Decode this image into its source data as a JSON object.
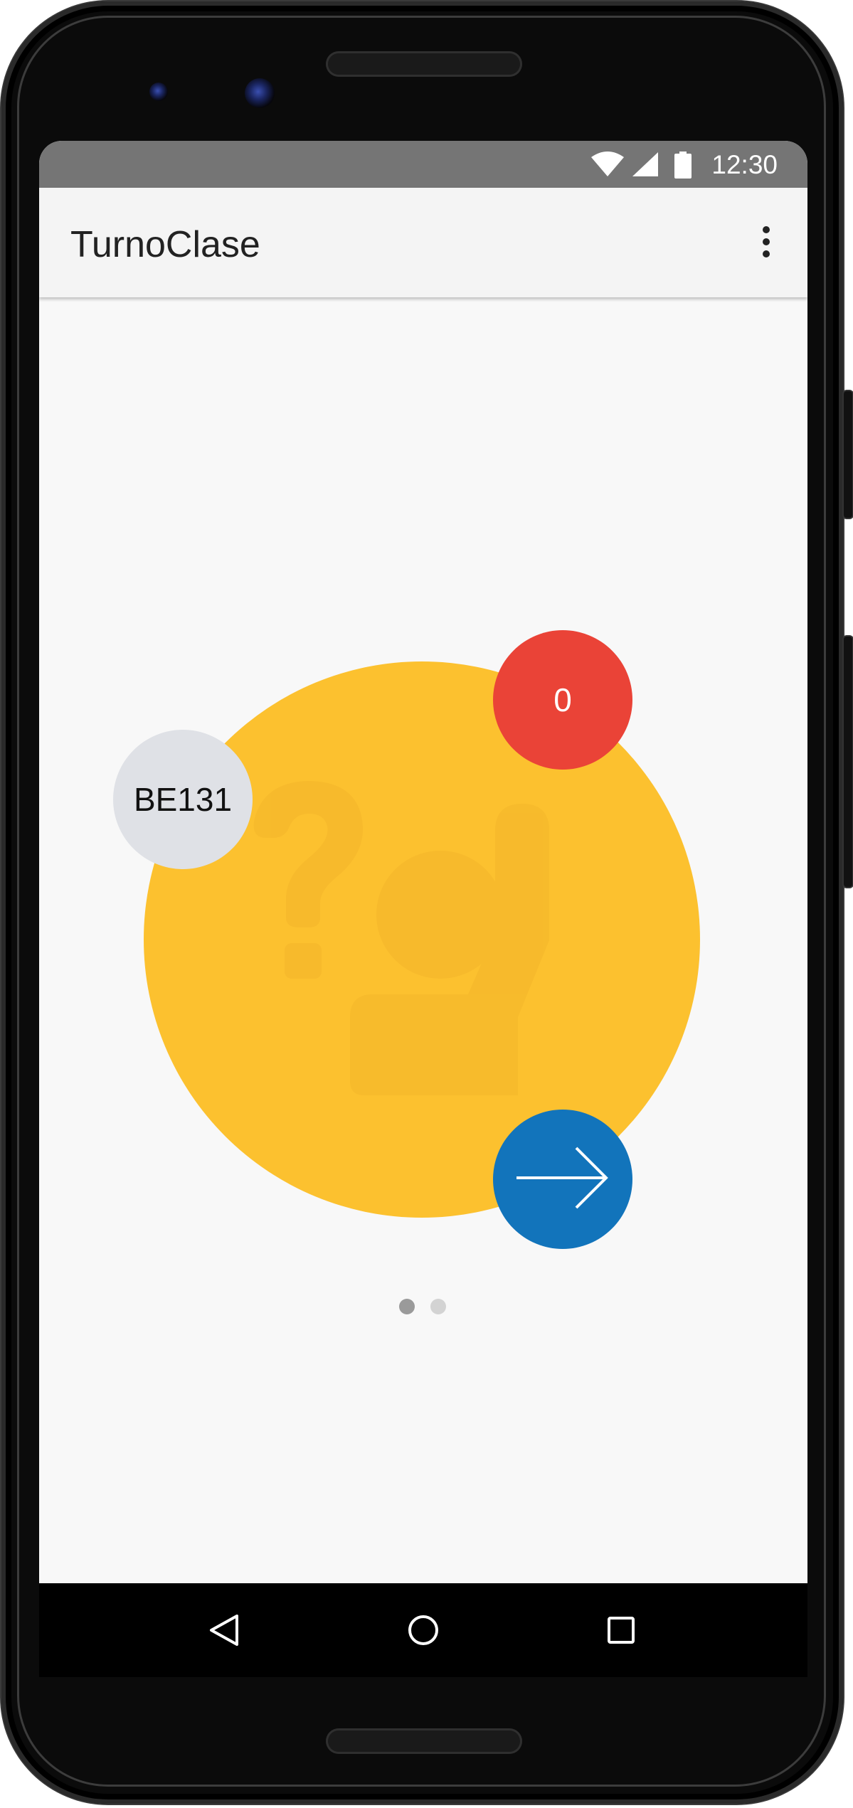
{
  "status_bar": {
    "time": "12:30",
    "icons": [
      "wifi-icon",
      "signal-icon",
      "battery-icon"
    ],
    "color": "#757575"
  },
  "app_bar": {
    "title": "TurnoClase",
    "menu_icon": "overflow-menu-icon"
  },
  "main": {
    "room_code": "BE131",
    "queue_count": "0",
    "center_icon": "student-raise-hand-question-icon",
    "next_icon": "arrow-right-icon",
    "pager": {
      "pages": 2,
      "current": 1
    }
  },
  "nav_bar": {
    "buttons": [
      "back-icon",
      "home-icon",
      "recents-icon"
    ]
  },
  "colors": {
    "main_circle": "#fcc12f",
    "room_badge": "#dfe1e6",
    "count_badge": "#ea4337",
    "next_button": "#1274bb",
    "background": "#f8f8f8"
  }
}
